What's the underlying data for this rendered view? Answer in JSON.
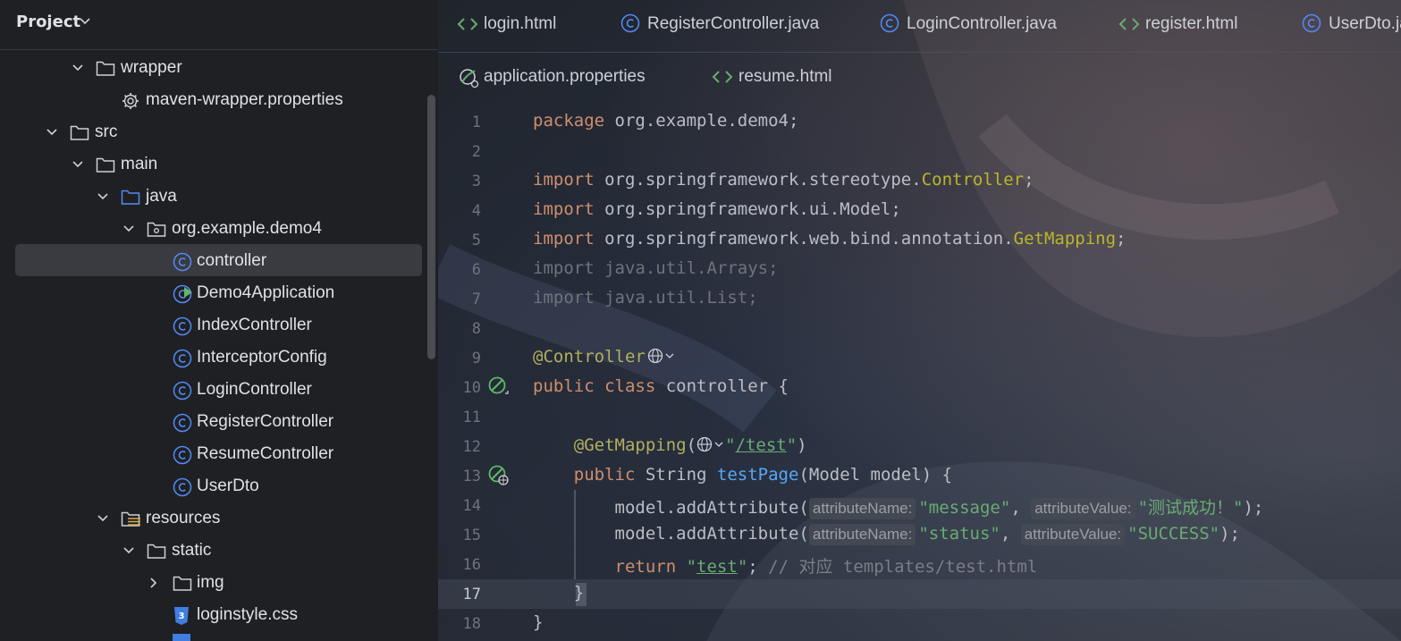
{
  "project": {
    "title": "Project",
    "tree": [
      {
        "label": "wrapper",
        "icon": "folder-icon",
        "expanded": true
      },
      {
        "label": "maven-wrapper.properties",
        "icon": "gear-icon"
      },
      {
        "label": "src",
        "icon": "folder-icon",
        "expanded": true
      },
      {
        "label": "main",
        "icon": "folder-icon",
        "expanded": true
      },
      {
        "label": "java",
        "icon": "source-folder-icon",
        "expanded": true
      },
      {
        "label": "org.example.demo4",
        "icon": "package-icon",
        "expanded": true
      },
      {
        "label": "controller",
        "icon": "class-icon",
        "selected": true
      },
      {
        "label": "Demo4Application",
        "icon": "run-class-icon"
      },
      {
        "label": "IndexController",
        "icon": "class-icon"
      },
      {
        "label": "InterceptorConfig",
        "icon": "class-icon"
      },
      {
        "label": "LoginController",
        "icon": "class-icon"
      },
      {
        "label": "RegisterController",
        "icon": "class-icon"
      },
      {
        "label": "ResumeController",
        "icon": "class-icon"
      },
      {
        "label": "UserDto",
        "icon": "class-icon"
      },
      {
        "label": "resources",
        "icon": "resources-folder-icon",
        "expanded": true
      },
      {
        "label": "static",
        "icon": "folder-icon",
        "expanded": true
      },
      {
        "label": "img",
        "icon": "folder-icon",
        "expanded": false
      },
      {
        "label": "loginstyle.css",
        "icon": "css-icon"
      }
    ]
  },
  "tabs": {
    "row1": [
      {
        "label": "login.html",
        "icon": "html-icon"
      },
      {
        "label": "RegisterController.java",
        "icon": "class-icon"
      },
      {
        "label": "LoginController.java",
        "icon": "class-icon"
      },
      {
        "label": "register.html",
        "icon": "html-icon"
      },
      {
        "label": "UserDto.ja",
        "icon": "class-icon"
      }
    ],
    "row2": [
      {
        "label": "application.properties",
        "icon": "spring-properties-icon"
      },
      {
        "label": "resume.html",
        "icon": "html-icon"
      }
    ]
  },
  "editor": {
    "current_line": 17,
    "line_numbers": [
      "1",
      "2",
      "3",
      "4",
      "5",
      "6",
      "7",
      "8",
      "9",
      "10",
      "11",
      "12",
      "13",
      "14",
      "15",
      "16",
      "17",
      "18"
    ],
    "code": {
      "l1_kw": "package",
      "l1_rest": " org.example.demo4;",
      "l3_kw": "import",
      "l3_pkg": " org.springframework.stereotype.",
      "l3_cls": "Controller",
      "l3_end": ";",
      "l4_kw": "import",
      "l4_rest": " org.springframework.ui.Model;",
      "l5_kw": "import",
      "l5_pkg": " org.springframework.web.bind.annotation.",
      "l5_cls": "GetMapping",
      "l5_end": ";",
      "l6": "import java.util.Arrays;",
      "l7": "import java.util.List;",
      "l9_ann": "@Controller",
      "l10_kw": "public class",
      "l10_rest": " controller {",
      "l12_ann": "@GetMapping",
      "l12_open": "(",
      "l12_q1": "\"",
      "l12_str": "/test",
      "l12_q2": "\"",
      "l12_close": ")",
      "l13_kw": "public",
      "l13_type": " String ",
      "l13_fn": "testPage",
      "l13_rest": "(Model model) {",
      "l14_call": "model.addAttribute(",
      "l14_hint1": "attributeName:",
      "l14_str1": "\"message\"",
      "l14_sep": ", ",
      "l14_hint2": "attributeValue:",
      "l14_str2": "\"测试成功！\"",
      "l14_end": ");",
      "l15_call": "model.addAttribute(",
      "l15_hint1": "attributeName:",
      "l15_str1": "\"status\"",
      "l15_sep": ", ",
      "l15_hint2": "attributeValue:",
      "l15_str2": "\"SUCCESS\"",
      "l15_end": ");",
      "l16_kw": "return",
      "l16_q1": " \"",
      "l16_str": "test",
      "l16_q2": "\"",
      "l16_semi": ";",
      "l16_cmt": " // 对应 templates/test.html",
      "l17": "}",
      "l18": "}"
    }
  }
}
